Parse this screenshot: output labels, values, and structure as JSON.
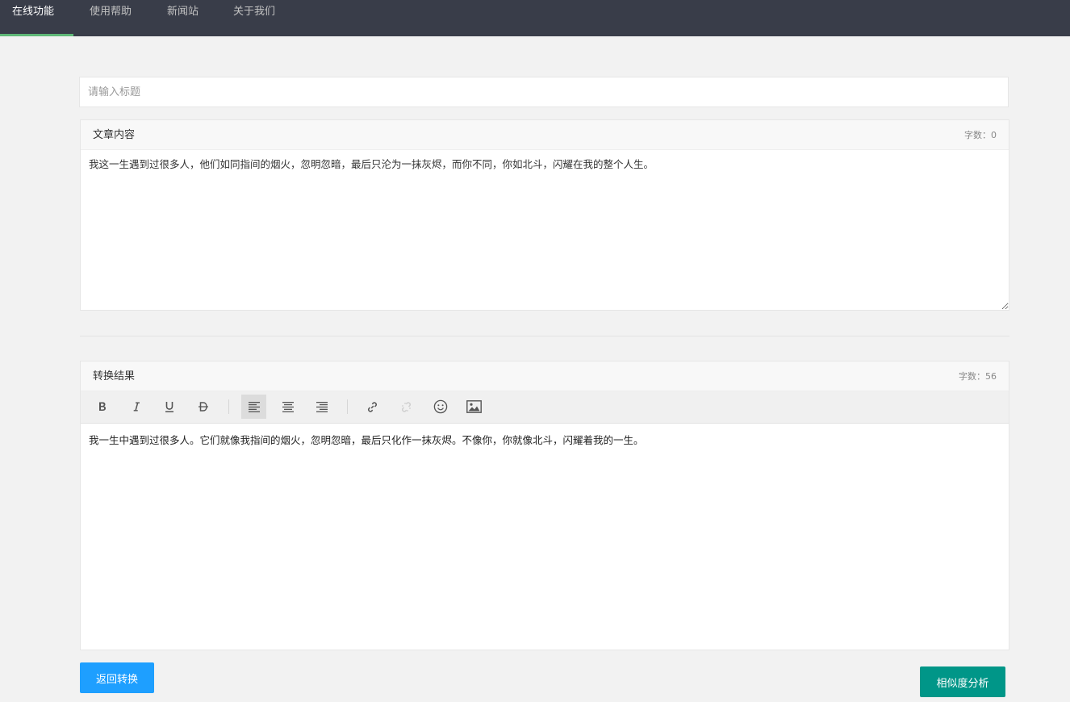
{
  "nav": {
    "items": [
      {
        "label": "在线功能"
      },
      {
        "label": "使用帮助"
      },
      {
        "label": "新闻站"
      },
      {
        "label": "关于我们"
      }
    ],
    "active_index": 0,
    "accent_color": "#5fb878"
  },
  "title_field": {
    "placeholder": "请输入标题",
    "value": ""
  },
  "source": {
    "title": "文章内容",
    "count_text": "字数：0",
    "text": "我这一生遇到过很多人，他们如同指间的烟火，忽明忽暗，最后只沦为一抹灰烬，而你不同，你如北斗，闪耀在我的整个人生。"
  },
  "result": {
    "title": "转换结果",
    "count_text": "字数：56",
    "text": "我一生中遇到过很多人。它们就像我指间的烟火，忽明忽暗，最后只化作一抹灰烬。不像你，你就像北斗，闪耀着我的一生。",
    "toolbar": [
      {
        "icon": "bold-icon",
        "state": "normal"
      },
      {
        "icon": "italic-icon",
        "state": "normal"
      },
      {
        "icon": "underline-icon",
        "state": "normal"
      },
      {
        "icon": "strikethrough-icon",
        "state": "normal"
      },
      {
        "icon": "align-left-icon",
        "state": "active"
      },
      {
        "icon": "align-center-icon",
        "state": "normal"
      },
      {
        "icon": "align-right-icon",
        "state": "normal"
      },
      {
        "icon": "link-icon",
        "state": "normal"
      },
      {
        "icon": "unlink-icon",
        "state": "disabled"
      },
      {
        "icon": "emoji-icon",
        "state": "normal"
      },
      {
        "icon": "image-icon",
        "state": "normal"
      }
    ]
  },
  "buttons": {
    "back_label": "返回转换",
    "back_color": "#1e9fff",
    "analyze_label": "相似度分析",
    "analyze_color": "#009688"
  }
}
